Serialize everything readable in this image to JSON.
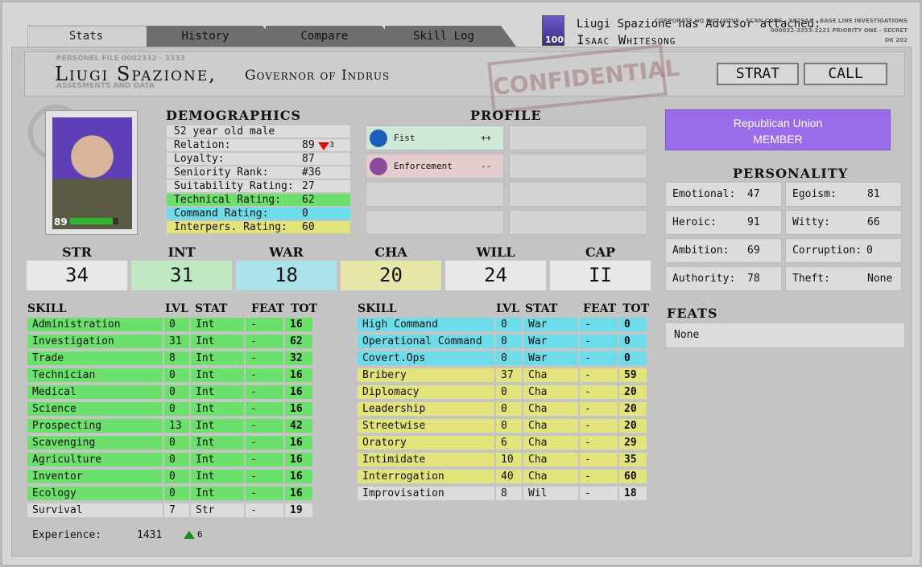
{
  "tabs": [
    "Stats",
    "History",
    "Compare",
    "Skill Log"
  ],
  "advisor": {
    "portrait_hp": "100",
    "line1": "Liugi Spazione has Advisor attached:",
    "name": "Isaac Whitesong"
  },
  "corp_note": [
    "CORPORATE HQ INCLUSIVE - SCAN CODE - X029AA - BASE LINE INVESTIGATIONS",
    "000022-3333-2221 PRIORITY ONE - SECRET",
    "OK 202"
  ],
  "file": {
    "personel": "PERSONEL FILE   0002332 - 3333",
    "assessments": "ASSESMENTS AND DATA",
    "name": "Liugi Spazione,",
    "title": "Governor of Indrus",
    "stamp": "CONFIDENTIAL"
  },
  "buttons": {
    "strat": "STRAT",
    "call": "CALL"
  },
  "portrait": {
    "hp": "89",
    "hp_fraction": 0.89
  },
  "demographics": {
    "heading": "DEMOGRAPHICS",
    "rows": [
      {
        "label": "52 year old male",
        "value": ""
      },
      {
        "label": "Relation:",
        "value": "89",
        "delta": "3"
      },
      {
        "label": "Loyalty:",
        "value": "87"
      },
      {
        "label": "Seniority Rank:",
        "value": "#36"
      },
      {
        "label": "Suitability Rating:",
        "value": "27"
      },
      {
        "label": "Technical Rating:",
        "value": "62"
      },
      {
        "label": "Command Rating:",
        "value": "0"
      },
      {
        "label": "Interpers. Rating:",
        "value": "60"
      }
    ]
  },
  "profile": {
    "heading": "PROFILE",
    "items": [
      {
        "label": "Fist",
        "mod": "++"
      },
      {
        "label": "Enforcement",
        "mod": "--"
      }
    ]
  },
  "membership": {
    "line1": "Republican Union",
    "line2": "MEMBER"
  },
  "personality": {
    "heading": "PERSONALITY",
    "cells": [
      {
        "label": "Emotional:",
        "value": "47"
      },
      {
        "label": "Egoism:",
        "value": "81"
      },
      {
        "label": "Heroic:",
        "value": "91"
      },
      {
        "label": "Witty:",
        "value": "66"
      },
      {
        "label": "Ambition:",
        "value": "69"
      },
      {
        "label": "Corruption:",
        "value": "0"
      },
      {
        "label": "Authority:",
        "value": "78"
      },
      {
        "label": "Theft:",
        "value": "None"
      }
    ]
  },
  "attributes": [
    {
      "name": "STR",
      "value": "34"
    },
    {
      "name": "INT",
      "value": "31"
    },
    {
      "name": "WAR",
      "value": "18"
    },
    {
      "name": "CHA",
      "value": "20"
    },
    {
      "name": "WILL",
      "value": "24"
    },
    {
      "name": "CAP",
      "value": "II"
    }
  ],
  "skill_headers": {
    "skill": "SKILL",
    "lvl": "LVL",
    "stat": "STAT",
    "feat": "FEAT",
    "tot": "TOT"
  },
  "skills_left": [
    {
      "skill": "Administration",
      "lvl": "0",
      "stat": "Int",
      "feat": "-",
      "tot": "16"
    },
    {
      "skill": "Investigation",
      "lvl": "31",
      "stat": "Int",
      "feat": "-",
      "tot": "62"
    },
    {
      "skill": "Trade",
      "lvl": "8",
      "stat": "Int",
      "feat": "-",
      "tot": "32"
    },
    {
      "skill": "Technician",
      "lvl": "0",
      "stat": "Int",
      "feat": "-",
      "tot": "16"
    },
    {
      "skill": "Medical",
      "lvl": "0",
      "stat": "Int",
      "feat": "-",
      "tot": "16"
    },
    {
      "skill": "Science",
      "lvl": "0",
      "stat": "Int",
      "feat": "-",
      "tot": "16"
    },
    {
      "skill": "Prospecting",
      "lvl": "13",
      "stat": "Int",
      "feat": "-",
      "tot": "42"
    },
    {
      "skill": "Scavenging",
      "lvl": "0",
      "stat": "Int",
      "feat": "-",
      "tot": "16"
    },
    {
      "skill": "Agriculture",
      "lvl": "0",
      "stat": "Int",
      "feat": "-",
      "tot": "16"
    },
    {
      "skill": "Inventor",
      "lvl": "0",
      "stat": "Int",
      "feat": "-",
      "tot": "16"
    },
    {
      "skill": "Ecology",
      "lvl": "0",
      "stat": "Int",
      "feat": "-",
      "tot": "16"
    },
    {
      "skill": "Survival",
      "lvl": "7",
      "stat": "Str",
      "feat": "-",
      "tot": "19"
    }
  ],
  "skills_right": [
    {
      "skill": "High Command",
      "lvl": "0",
      "stat": "War",
      "feat": "-",
      "tot": "0"
    },
    {
      "skill": "Operational Command",
      "lvl": "0",
      "stat": "War",
      "feat": "-",
      "tot": "0"
    },
    {
      "skill": "Covert.Ops",
      "lvl": "0",
      "stat": "War",
      "feat": "-",
      "tot": "0"
    },
    {
      "skill": "Bribery",
      "lvl": "37",
      "stat": "Cha",
      "feat": "-",
      "tot": "59"
    },
    {
      "skill": "Diplomacy",
      "lvl": "0",
      "stat": "Cha",
      "feat": "-",
      "tot": "20"
    },
    {
      "skill": "Leadership",
      "lvl": "0",
      "stat": "Cha",
      "feat": "-",
      "tot": "20"
    },
    {
      "skill": "Streetwise",
      "lvl": "0",
      "stat": "Cha",
      "feat": "-",
      "tot": "20"
    },
    {
      "skill": "Oratory",
      "lvl": "6",
      "stat": "Cha",
      "feat": "-",
      "tot": "29"
    },
    {
      "skill": "Intimidate",
      "lvl": "10",
      "stat": "Cha",
      "feat": "-",
      "tot": "35"
    },
    {
      "skill": "Interrogation",
      "lvl": "40",
      "stat": "Cha",
      "feat": "-",
      "tot": "60"
    },
    {
      "skill": "Improvisation",
      "lvl": "8",
      "stat": "Wil",
      "feat": "-",
      "tot": "18"
    }
  ],
  "feats": {
    "heading": "FEATS",
    "value": "None"
  },
  "experience": {
    "label": "Experience:",
    "value": "1431",
    "delta": "6"
  },
  "colors": {
    "green": "#6be06b",
    "cyan": "#6ddcea",
    "yellow": "#e3e37c",
    "purple": "#9a6cea",
    "grey": "#dcdcdc"
  }
}
